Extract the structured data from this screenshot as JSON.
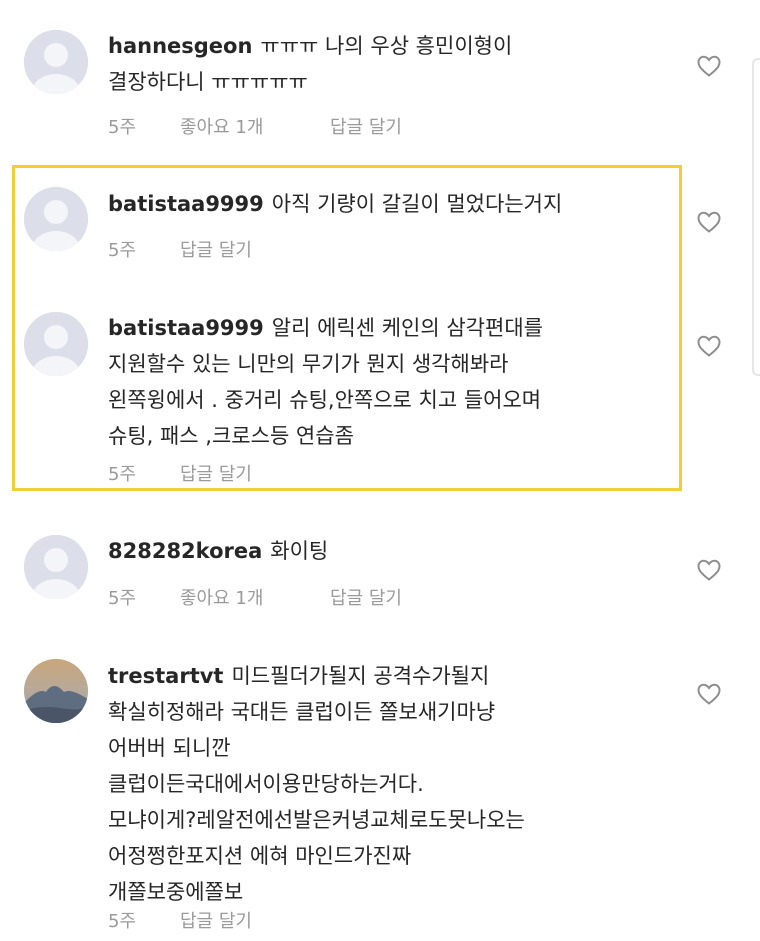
{
  "comments": [
    {
      "username": "hannesgeon",
      "lines": [
        "ㅠㅠㅠ 나의 우상 흥민이형이",
        "결장하다니 ㅠㅠㅠㅠㅠ"
      ],
      "time": "5주",
      "likes": "좋아요 1개",
      "reply": "답글 달기",
      "avatar": "default-avatar-icon"
    },
    {
      "username": "batistaa9999",
      "lines": [
        "아직 기량이 갈길이 멀었다는거지"
      ],
      "time": "5주",
      "likes": "",
      "reply": "답글 달기",
      "avatar": "default-avatar-icon"
    },
    {
      "username": "batistaa9999",
      "lines": [
        "알리 에릭센 케인의 삼각편대를",
        "지원할수 있는 니만의 무기가 뭔지 생각해봐라",
        "왼쪽윙에서 . 중거리 슈팅,안쪽으로 치고 들어오며",
        "슈팅, 패스 ,크로스등 연습좀"
      ],
      "time": "5주",
      "likes": "",
      "reply": "답글 달기",
      "avatar": "default-avatar-icon"
    },
    {
      "username": "828282korea",
      "lines": [
        "화이팅"
      ],
      "time": "5주",
      "likes": "좋아요 1개",
      "reply": "답글 달기",
      "avatar": "default-avatar-icon"
    },
    {
      "username": "trestartvt",
      "lines": [
        "미드필더가될지 공격수가될지",
        "확실히정해라 국대든 클럽이든 쫄보새기마냥",
        "어버버 되니깐",
        "클럽이든국대에서이용만당하는거다.",
        "모냐이게?레알전에선발은커녕교체로도못나오는",
        "어정쩡한포지션 에혀  마인드가진짜",
        "개쫄보중에쫄보"
      ],
      "time": "5주",
      "likes": "",
      "reply": "답글 달기",
      "avatar": "landscape-photo-avatar"
    }
  ],
  "colors": {
    "highlight_border": "#f2cf35",
    "meta_text": "#9a9a9a",
    "avatar_bg": "#dcdfe9"
  }
}
